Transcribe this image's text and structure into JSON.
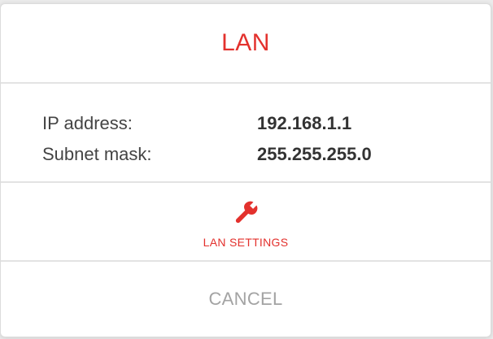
{
  "dialog": {
    "title": "LAN",
    "accent_color": "#e3312d"
  },
  "info": {
    "rows": [
      {
        "label": "IP address:",
        "value": "192.168.1.1"
      },
      {
        "label": "Subnet mask:",
        "value": "255.255.255.0"
      }
    ]
  },
  "settings": {
    "icon": "wrench-icon",
    "label": "LAN SETTINGS"
  },
  "cancel": {
    "label": "CANCEL"
  }
}
